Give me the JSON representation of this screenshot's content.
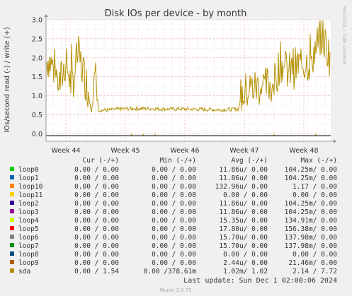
{
  "chart_data": {
    "type": "line",
    "title": "Disk IOs per device - by month",
    "ylabel": "IOs/second read (-) / write (+)",
    "side_label": "RRDTOOL / TOBI OETIKER",
    "ylim": [
      -0.2,
      3.0
    ],
    "y_ticks": [
      "3.0",
      "2.5",
      "2.0",
      "1.5",
      "1.0",
      "0.5",
      "0.0"
    ],
    "x_ticks": [
      "Week 44",
      "Week 45",
      "Week 46",
      "Week 47",
      "Week 48"
    ],
    "grid": true,
    "legend_position": "bottom",
    "columns": [
      "Cur (-/+)",
      "Min (-/+)",
      "Avg (-/+)",
      "Max (-/+)"
    ],
    "series": [
      {
        "name": "loop0",
        "color": "#00cc00",
        "cur": "0.00 /  0.00",
        "min": "0.00 /  0.00",
        "avg": "11.86u/  0.00",
        "max": "104.25m/  0.00"
      },
      {
        "name": "loop1",
        "color": "#0066b3",
        "cur": "0.00 /  0.00",
        "min": "0.00 /  0.00",
        "avg": "11.86u/  0.00",
        "max": "104.25m/  0.00"
      },
      {
        "name": "loop10",
        "color": "#ff8000",
        "cur": "0.00 /  0.00",
        "min": "0.00 /  0.00",
        "avg": "132.96u/  0.00",
        "max": "1.17 /  0.00"
      },
      {
        "name": "loop11",
        "color": "#ffcc00",
        "cur": "0.00 /  0.00",
        "min": "0.00 /  0.00",
        "avg": "0.00 /  0.00",
        "max": "0.00 /  0.00"
      },
      {
        "name": "loop2",
        "color": "#330099",
        "cur": "0.00 /  0.00",
        "min": "0.00 /  0.00",
        "avg": "11.86u/  0.00",
        "max": "104.25m/  0.00"
      },
      {
        "name": "loop3",
        "color": "#990099",
        "cur": "0.00 /  0.00",
        "min": "0.00 /  0.00",
        "avg": "11.86u/  0.00",
        "max": "104.25m/  0.00"
      },
      {
        "name": "loop4",
        "color": "#ccff00",
        "cur": "0.00 /  0.00",
        "min": "0.00 /  0.00",
        "avg": "15.35u/  0.00",
        "max": "134.91m/  0.00"
      },
      {
        "name": "loop5",
        "color": "#ff0000",
        "cur": "0.00 /  0.00",
        "min": "0.00 /  0.00",
        "avg": "17.80u/  0.00",
        "max": "156.38m/  0.00"
      },
      {
        "name": "loop6",
        "color": "#808080",
        "cur": "0.00 /  0.00",
        "min": "0.00 /  0.00",
        "avg": "15.70u/  0.00",
        "max": "137.98m/  0.00"
      },
      {
        "name": "loop7",
        "color": "#008f00",
        "cur": "0.00 /  0.00",
        "min": "0.00 /  0.00",
        "avg": "15.70u/  0.00",
        "max": "137.98m/  0.00"
      },
      {
        "name": "loop8",
        "color": "#00487d",
        "cur": "0.00 /  0.00",
        "min": "0.00 /  0.00",
        "avg": "0.00 /  0.00",
        "max": "0.00 /  0.00"
      },
      {
        "name": "loop9",
        "color": "#b35a00",
        "cur": "0.00 /  0.00",
        "min": "0.00 /  0.00",
        "avg": "2.44u/  0.00",
        "max": "21.46m/  0.00"
      },
      {
        "name": "sda",
        "color": "#b38f00",
        "cur": "0.00 /  1.54",
        "min": "0.00 /378.61m",
        "avg": "1.02m/  1.02",
        "max": "2.14 /  7.72"
      }
    ],
    "sda_write_profile": [
      {
        "week": 43.6,
        "y": 1.5
      },
      {
        "week": 43.7,
        "y": 2.0
      },
      {
        "week": 43.8,
        "y": 1.7
      },
      {
        "week": 43.9,
        "y": 1.3
      },
      {
        "week": 44.0,
        "y": 1.9
      },
      {
        "week": 44.1,
        "y": 1.2
      },
      {
        "week": 44.2,
        "y": 2.1
      },
      {
        "week": 44.3,
        "y": 1.6
      },
      {
        "week": 44.4,
        "y": 1.0
      },
      {
        "week": 44.5,
        "y": 1.4
      },
      {
        "week": 44.55,
        "y": 0.62
      },
      {
        "week": 44.7,
        "y": 0.62
      },
      {
        "week": 44.9,
        "y": 0.65
      },
      {
        "week": 45.1,
        "y": 0.66
      },
      {
        "week": 45.4,
        "y": 0.66
      },
      {
        "week": 45.7,
        "y": 0.65
      },
      {
        "week": 46.0,
        "y": 0.65
      },
      {
        "week": 46.3,
        "y": 0.64
      },
      {
        "week": 46.6,
        "y": 0.63
      },
      {
        "week": 46.9,
        "y": 0.65
      },
      {
        "week": 46.95,
        "y": 1.0
      },
      {
        "week": 47.1,
        "y": 1.2
      },
      {
        "week": 47.3,
        "y": 1.25
      },
      {
        "week": 47.5,
        "y": 1.3
      },
      {
        "week": 47.6,
        "y": 1.9
      },
      {
        "week": 47.75,
        "y": 1.6
      },
      {
        "week": 47.9,
        "y": 1.8
      },
      {
        "week": 48.1,
        "y": 1.9
      },
      {
        "week": 48.3,
        "y": 2.6
      },
      {
        "week": 48.4,
        "y": 2.2
      },
      {
        "week": 48.55,
        "y": 1.5
      }
    ],
    "sda_read_dips": [
      45.1,
      45.3,
      45.5,
      47.5,
      48.2
    ]
  },
  "footer": {
    "last_update": "Last update: Sun Dec  1 02:00:06 2024",
    "version": "Munin 2.0.75"
  }
}
